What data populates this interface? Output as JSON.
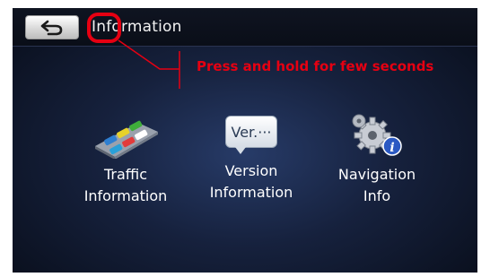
{
  "header": {
    "title": "Information",
    "back_icon": "back-arrow-icon"
  },
  "annotation": {
    "text": "Press and hold for few seconds",
    "color": "#e60012"
  },
  "menu": {
    "items": [
      {
        "label": "Traffic\nInformation",
        "icon": "traffic-cars-icon"
      },
      {
        "label": "Version\nInformation",
        "icon": "version-bubble-icon",
        "icon_text": "Ver.···"
      },
      {
        "label": "Navigation\nInfo",
        "icon": "gears-info-icon"
      }
    ]
  }
}
